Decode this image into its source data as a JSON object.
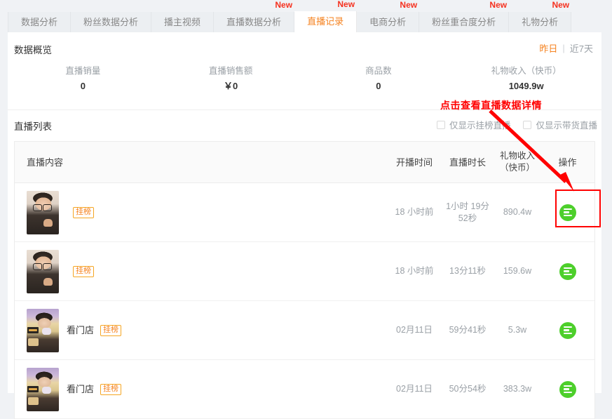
{
  "tabs": [
    {
      "label": "数据分析",
      "new": false,
      "active": false
    },
    {
      "label": "粉丝数据分析",
      "new": false,
      "active": false
    },
    {
      "label": "播主视频",
      "new": false,
      "active": false
    },
    {
      "label": "直播数据分析",
      "new": true,
      "new_label": "New",
      "active": false
    },
    {
      "label": "直播记录",
      "new": true,
      "new_label": "New",
      "active": true
    },
    {
      "label": "电商分析",
      "new": true,
      "new_label": "New",
      "active": false
    },
    {
      "label": "粉丝重合度分析",
      "new": true,
      "new_label": "New",
      "active": false
    },
    {
      "label": "礼物分析",
      "new": true,
      "new_label": "New",
      "active": false
    }
  ],
  "overview": {
    "title": "数据概览",
    "range": {
      "options": [
        {
          "label": "昨日",
          "active": true
        },
        {
          "label": "近7天",
          "active": false
        }
      ],
      "separator": "|"
    },
    "metrics": [
      {
        "label": "直播销量",
        "value": "0"
      },
      {
        "label": "直播销售额",
        "value": "￥0"
      },
      {
        "label": "商品数",
        "value": "0"
      },
      {
        "label": "礼物收入（快币）",
        "value": "1049.9w"
      }
    ]
  },
  "list": {
    "title": "直播列表",
    "filters": [
      {
        "label": "仅显示挂榜直播",
        "checked": false
      },
      {
        "label": "仅显示带货直播",
        "checked": false
      }
    ],
    "columns": {
      "content": "直播内容",
      "start": "开播时间",
      "duration": "直播时长",
      "gift": "礼物收入（快币）",
      "gift_line1": "礼物收入",
      "gift_line2": "（快币）",
      "action": "操作"
    },
    "rows": [
      {
        "avatar": "avA",
        "name": "",
        "tag": "挂榜",
        "start": "18 小时前",
        "duration": "1小时 19分 52秒",
        "duration_line1": "1小时 19分",
        "duration_line2": "52秒",
        "gift": "890.4w"
      },
      {
        "avatar": "avA",
        "name": "",
        "tag": "挂榜",
        "start": "18 小时前",
        "duration": "13分11秒",
        "duration_line1": "13分11秒",
        "duration_line2": "",
        "gift": "159.6w"
      },
      {
        "avatar": "avB",
        "name": "看门店",
        "tag": "挂榜",
        "start": "02月11日",
        "duration": "59分41秒",
        "duration_line1": "59分41秒",
        "duration_line2": "",
        "gift": "5.3w"
      },
      {
        "avatar": "avB",
        "name": "看门店",
        "tag": "挂榜",
        "start": "02月11日",
        "duration": "50分54秒",
        "duration_line1": "50分54秒",
        "duration_line2": "",
        "gift": "383.3w"
      }
    ]
  },
  "annotation": {
    "text": "点击查看直播数据详情",
    "color": "#ff0000"
  },
  "colors": {
    "accent": "#f5821f",
    "new_badge": "#f5311f",
    "action_green": "#4dcf2b",
    "annotation_red": "#ff0000",
    "page_bg": "#f0f2f5"
  }
}
